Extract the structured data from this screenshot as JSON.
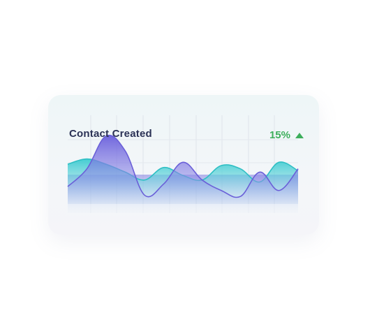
{
  "card": {
    "title": "Contact Created",
    "change_value": "15%",
    "change_icon": "arrow-up-icon"
  },
  "colors": {
    "title": "#2b3256",
    "positive": "#3dae5c",
    "series_purple": "#6f62dc",
    "series_teal": "#37c3c9"
  },
  "chart_data": {
    "type": "area",
    "x": [
      0,
      1,
      2,
      3,
      4,
      5,
      6,
      7,
      8,
      9,
      10,
      11,
      12
    ],
    "ylim": [
      0,
      100
    ],
    "grid": true,
    "series": [
      {
        "values": [
          18,
          45,
          95,
          72,
          5,
          22,
          55,
          28,
          12,
          3,
          40,
          12,
          45
        ]
      },
      {
        "values": [
          52,
          60,
          52,
          40,
          28,
          47,
          35,
          28,
          50,
          45,
          25,
          55,
          42
        ]
      }
    ]
  }
}
